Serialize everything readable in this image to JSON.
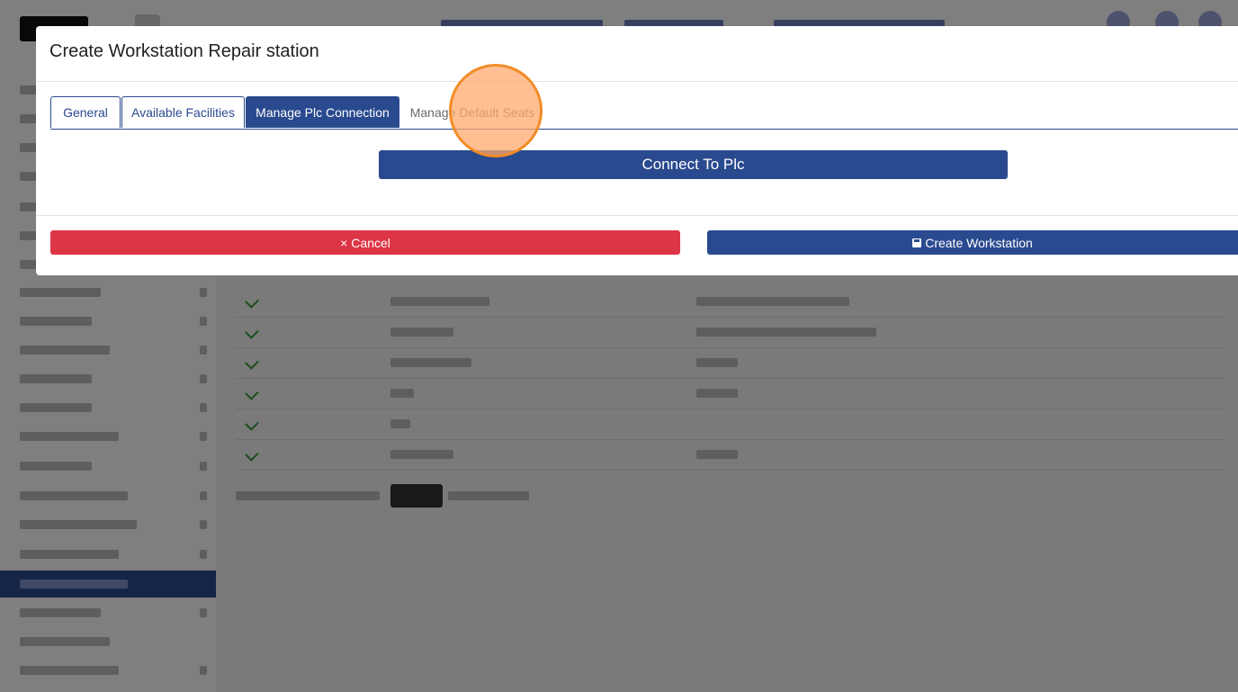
{
  "modal": {
    "title": "Create Workstation Repair station",
    "tabs": [
      {
        "label": "General",
        "state": "default"
      },
      {
        "label": "Available Facilities",
        "state": "default"
      },
      {
        "label": "Manage Plc Connection",
        "state": "active"
      },
      {
        "label": "Manage Default Seats",
        "state": "plain"
      }
    ],
    "connect_label": "Connect To Plc",
    "cancel_label": "Cancel",
    "cancel_icon": "×",
    "create_label": "Create Workstation",
    "create_icon": "save-icon"
  },
  "colors": {
    "primary": "#2a4a8f",
    "danger": "#dc3545",
    "highlight": "#f28c28"
  }
}
